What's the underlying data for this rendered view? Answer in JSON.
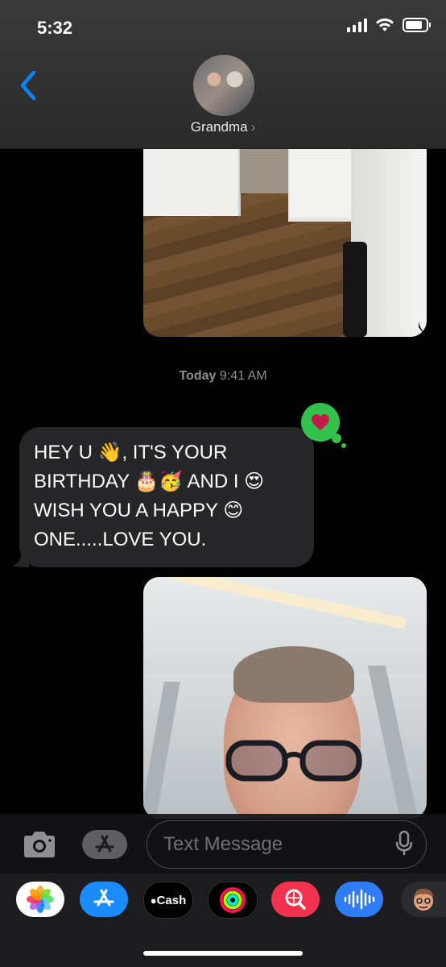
{
  "status_bar": {
    "time": "5:32"
  },
  "header": {
    "contact_name": "Grandma",
    "chevron": "›"
  },
  "thread": {
    "timestamp_day": "Today",
    "timestamp_time": "9:41 AM",
    "incoming_message": "HEY U 👋, IT'S YOUR\nBIRTHDAY 🎂🥳 AND I 😍\nWISH YOU A HAPPY 😊\nONE.....LOVE YOU.",
    "reaction": "heart-icon"
  },
  "composer": {
    "placeholder": "Text Message"
  },
  "app_drawer": {
    "apps": [
      "photos-icon",
      "app-store-icon",
      "apple-cash-icon",
      "activity-icon",
      "images-search-icon",
      "audio-message-icon",
      "memoji-icon"
    ],
    "cash_label": "Cash"
  },
  "colors": {
    "accent_blue": "#0a84ff",
    "reaction_green": "#33c24d",
    "bubble_gray": "#262629",
    "background": "#000000"
  }
}
